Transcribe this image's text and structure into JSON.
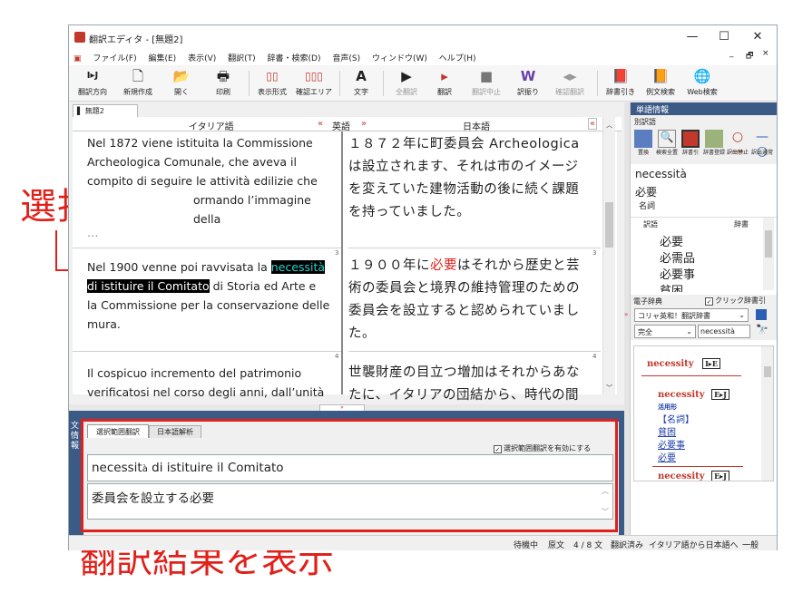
{
  "window": {
    "title": "翻訳エディタ - [無題2]",
    "controls": [
      "—",
      "☐",
      "✕"
    ],
    "mdi_controls": [
      "_",
      "🗗",
      "×"
    ]
  },
  "menu": [
    "ファイル(F)",
    "編集(E)",
    "表示(V)",
    "翻訳(T)",
    "辞書・検索(D)",
    "音声(S)",
    "ウィンドウ(W)",
    "ヘルプ(H)"
  ],
  "toolbar": [
    {
      "label": "翻訳方向",
      "icon": "I▸J",
      "enabled": true
    },
    {
      "label": "新規作成",
      "icon": "🗋",
      "enabled": true
    },
    {
      "label": "開く",
      "icon": "📂",
      "enabled": true
    },
    {
      "label": "印刷",
      "icon": "🖶",
      "enabled": true
    },
    {
      "label": "表示形式",
      "icon": "▯▯",
      "enabled": true
    },
    {
      "label": "確認エリア",
      "icon": "▯▯▯",
      "enabled": true
    },
    {
      "label": "文字",
      "icon": "A",
      "enabled": true
    },
    {
      "label": "全翻訳",
      "icon": "▶",
      "enabled": false
    },
    {
      "label": "翻訳",
      "icon": "▸",
      "enabled": true
    },
    {
      "label": "翻訳中止",
      "icon": "■",
      "enabled": false
    },
    {
      "label": "訳振り",
      "icon": "W",
      "enabled": true
    },
    {
      "label": "確認翻訳",
      "icon": "◂▸",
      "enabled": false
    },
    {
      "label": "辞書引き",
      "icon": "📕",
      "enabled": true
    },
    {
      "label": "例文検索",
      "icon": "📙",
      "enabled": true
    },
    {
      "label": "Web検索",
      "icon": "🌐",
      "enabled": true
    }
  ],
  "doc_tab": "無題2",
  "columns": {
    "source": "イタリア語",
    "direction": "英語",
    "target": "日本語"
  },
  "segments": [
    {
      "it_lines": [
        "Nel 1872 viene istituita la Commissione",
        "Archeologica Comunale, che aveva il",
        "compito di seguire le attività edilizie che",
        "ormando l’immagine della"
      ],
      "it_partial": "…",
      "ja_lines": [
        "１８７２年に町委員会 Archeologica",
        "は設立されます、それは市のイメージ",
        "を変えていた建物活動の後に続く課題",
        "を持っていました。"
      ],
      "num": "3"
    },
    {
      "it_line1_pre": "Nel 1900 venne poi ravvisata la ",
      "it_line1_sel": "necessità",
      "it_line2_sel": "di istituire il Comitato",
      "it_line2_post": " di Storia ed Arte e",
      "it_lines_rest": [
        "la Commissione per la conservazione delle",
        "mura."
      ],
      "ja_line1_pre": "１９００年に",
      "ja_line1_red": "必要",
      "ja_line1_post": "はそれから歴史と芸",
      "ja_lines_rest": [
        "術の委員会と境界の維持管理のための",
        "委員会を設立すると認められていまし",
        "た。"
      ],
      "num": "4"
    },
    {
      "it_lines": [
        "Il cospicuo incremento del patrimonio",
        "verificatosi nel corso degli anni, dall’unità"
      ],
      "ja_lines": [
        "世襲財産の目立つ増加はそれからあな",
        "たに、イタリアの団結から、時代の間"
      ]
    }
  ],
  "bottom": {
    "side_label": "文情報",
    "tabs": [
      "選択範囲翻訳",
      "日本語解析"
    ],
    "checkbox_label": "選択範囲翻訳を有効にする",
    "source_text_pre": "necessit",
    "source_text_small": "à",
    "source_text_post": " di istituire il Comitato",
    "result_text": "委員会を設立する必要"
  },
  "sidebar": {
    "header": "単語情報",
    "section1": "別訳語",
    "tools": [
      "置換",
      "検索全置",
      "辞書引",
      "辞書登録",
      "訳出禁止",
      "訳出通常"
    ],
    "word": "necessità",
    "word_translation": "必要",
    "word_pos": "名詞",
    "table_headers": [
      "訳語",
      "辞書"
    ],
    "alternatives": [
      "必要",
      "必需品",
      "必要事",
      "貧困"
    ],
    "edict_header": "電子辞典",
    "click_dict_label": "クリック辞書引",
    "dict_select": "コリャ英和！翻訳辞書",
    "match_select": "完全",
    "search_value": "necessità",
    "entries": [
      {
        "headword": "necessity",
        "tag": "I▸E"
      },
      {
        "headword": "necessity",
        "tag": "E▸J",
        "note": "活用形",
        "pos": "【名詞】",
        "meanings": [
          "貧困",
          "必要事",
          "必要"
        ]
      },
      {
        "headword": "necessity",
        "tag": "E▸J"
      }
    ]
  },
  "status": [
    "待機中",
    "原文",
    "4 / 8 文",
    "翻訳済み",
    "イタリア語から日本語へ",
    "一般"
  ],
  "annotations": {
    "selection": "選択範囲",
    "result": "翻訳結果を表示"
  }
}
